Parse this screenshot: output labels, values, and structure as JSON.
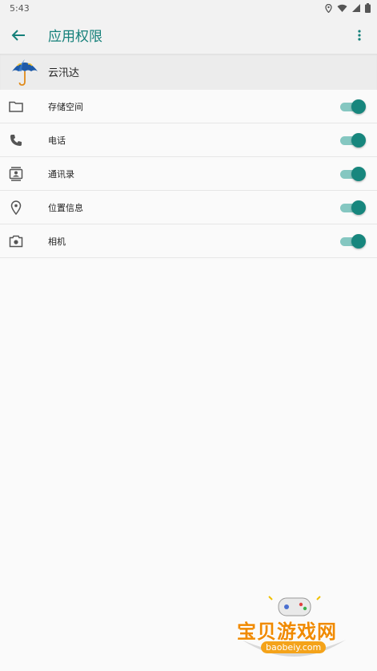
{
  "status_bar": {
    "time": "5:43"
  },
  "toolbar": {
    "title": "应用权限"
  },
  "app": {
    "name": "云汛达"
  },
  "permissions": [
    {
      "label": "存储空间",
      "icon": "folder-icon",
      "enabled": true
    },
    {
      "label": "电话",
      "icon": "phone-icon",
      "enabled": true
    },
    {
      "label": "通讯录",
      "icon": "contacts-icon",
      "enabled": true
    },
    {
      "label": "位置信息",
      "icon": "location-icon",
      "enabled": true
    },
    {
      "label": "相机",
      "icon": "camera-icon",
      "enabled": true
    }
  ],
  "watermark": {
    "title": "宝贝游戏网",
    "url": "baobeiy.com"
  },
  "colors": {
    "accent": "#15807a",
    "toggle_track": "#85c7c1",
    "toggle_thumb": "#17867d"
  }
}
